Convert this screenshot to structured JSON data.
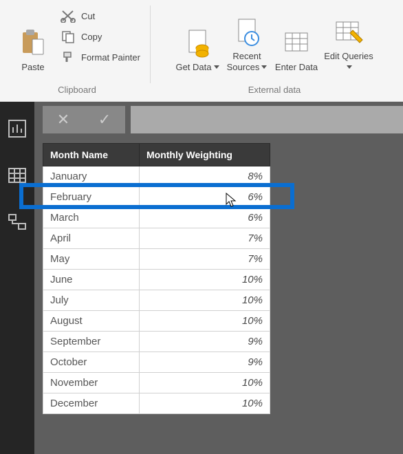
{
  "ribbon": {
    "clipboard_group": "Clipboard",
    "external_group": "External data",
    "paste": "Paste",
    "cut": "Cut",
    "copy": "Copy",
    "format_painter": "Format Painter",
    "get_data": "Get Data",
    "recent_sources": "Recent Sources",
    "enter_data": "Enter Data",
    "edit_queries": "Edit Queries"
  },
  "formula": {
    "cancel": "✕",
    "confirm": "✓"
  },
  "table": {
    "col1": "Month Name",
    "col2": "Monthly Weighting",
    "rows": [
      {
        "m": "January",
        "w": "8%"
      },
      {
        "m": "February",
        "w": "6%"
      },
      {
        "m": "March",
        "w": "6%"
      },
      {
        "m": "April",
        "w": "7%"
      },
      {
        "m": "May",
        "w": "7%"
      },
      {
        "m": "June",
        "w": "10%"
      },
      {
        "m": "July",
        "w": "10%"
      },
      {
        "m": "August",
        "w": "10%"
      },
      {
        "m": "September",
        "w": "9%"
      },
      {
        "m": "October",
        "w": "9%"
      },
      {
        "m": "November",
        "w": "10%"
      },
      {
        "m": "December",
        "w": "10%"
      }
    ]
  }
}
